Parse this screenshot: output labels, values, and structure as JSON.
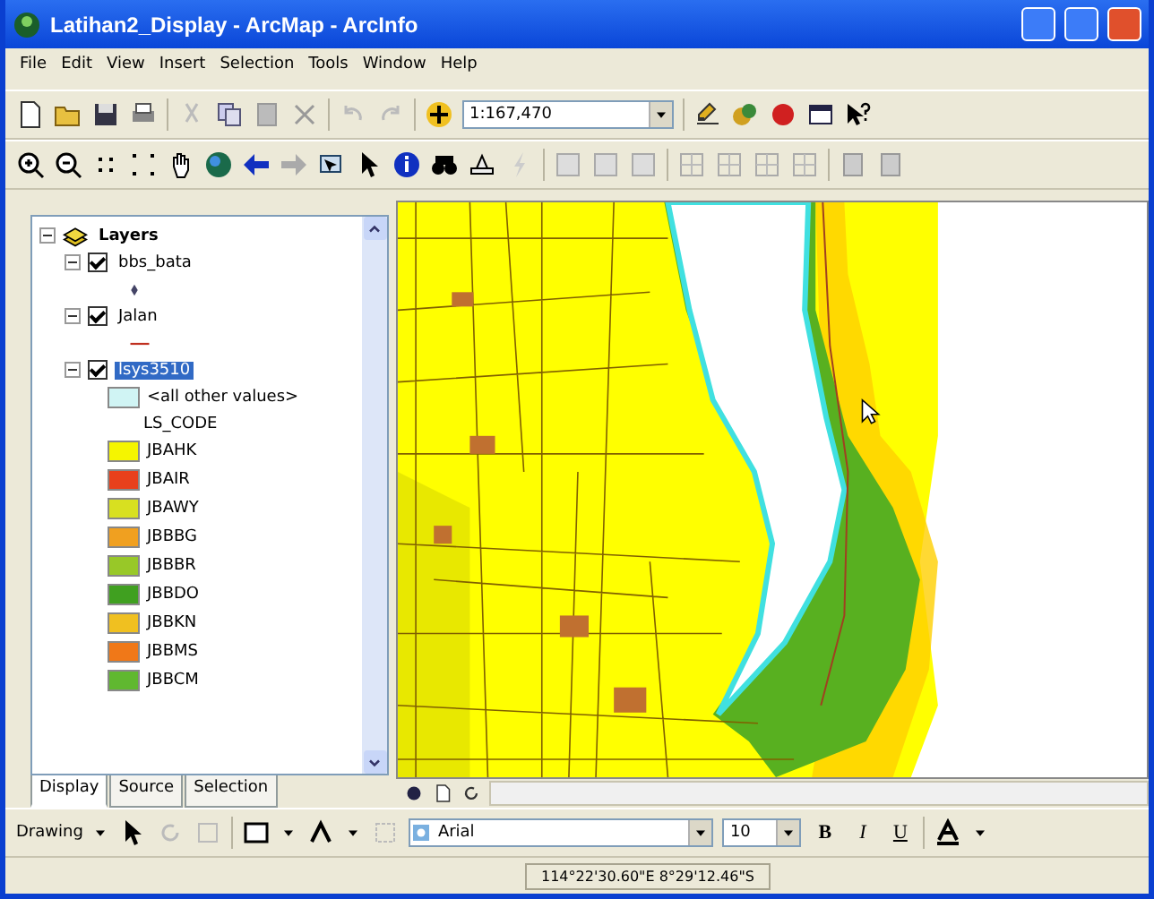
{
  "window": {
    "title": "Latihan2_Display - ArcMap - ArcInfo"
  },
  "menu": [
    "File",
    "Edit",
    "View",
    "Insert",
    "Selection",
    "Tools",
    "Window",
    "Help"
  ],
  "scale_field": {
    "value": "1:167,470"
  },
  "toc": {
    "root": {
      "label": "Layers",
      "expanded": true
    },
    "layers": [
      {
        "name": "bbs_bata",
        "checked": true,
        "expanded": true,
        "selected": false,
        "kind": "point"
      },
      {
        "name": "Jalan",
        "checked": true,
        "expanded": true,
        "selected": false,
        "kind": "line"
      },
      {
        "name": "lsys3510",
        "checked": true,
        "expanded": true,
        "selected": true,
        "kind": "classes",
        "other": "<all other values>",
        "field": "LS_CODE",
        "classes": [
          {
            "label": "JBAHK",
            "color": "#f5f500"
          },
          {
            "label": "JBAIR",
            "color": "#e8401c"
          },
          {
            "label": "JBAWY",
            "color": "#d8e020"
          },
          {
            "label": "JBBBG",
            "color": "#f0a020"
          },
          {
            "label": "JBBBR",
            "color": "#98c828"
          },
          {
            "label": "JBBDO",
            "color": "#40a020"
          },
          {
            "label": "JBBKN",
            "color": "#f0c020"
          },
          {
            "label": "JBBMS",
            "color": "#f07818"
          },
          {
            "label": "JBBCM",
            "color": "#60b830"
          }
        ]
      }
    ]
  },
  "toc_tabs": [
    {
      "label": "Display",
      "selected": true
    },
    {
      "label": "Source",
      "selected": false
    },
    {
      "label": "Selection",
      "selected": false
    }
  ],
  "drawing_toolbar": {
    "menu": "Drawing",
    "font": "Arial",
    "size": "10",
    "bold": "B",
    "italic": "I",
    "underline": "U"
  },
  "status_bar": {
    "coordinates": "114°22'30.60\"E  8°29'12.46\"S"
  }
}
